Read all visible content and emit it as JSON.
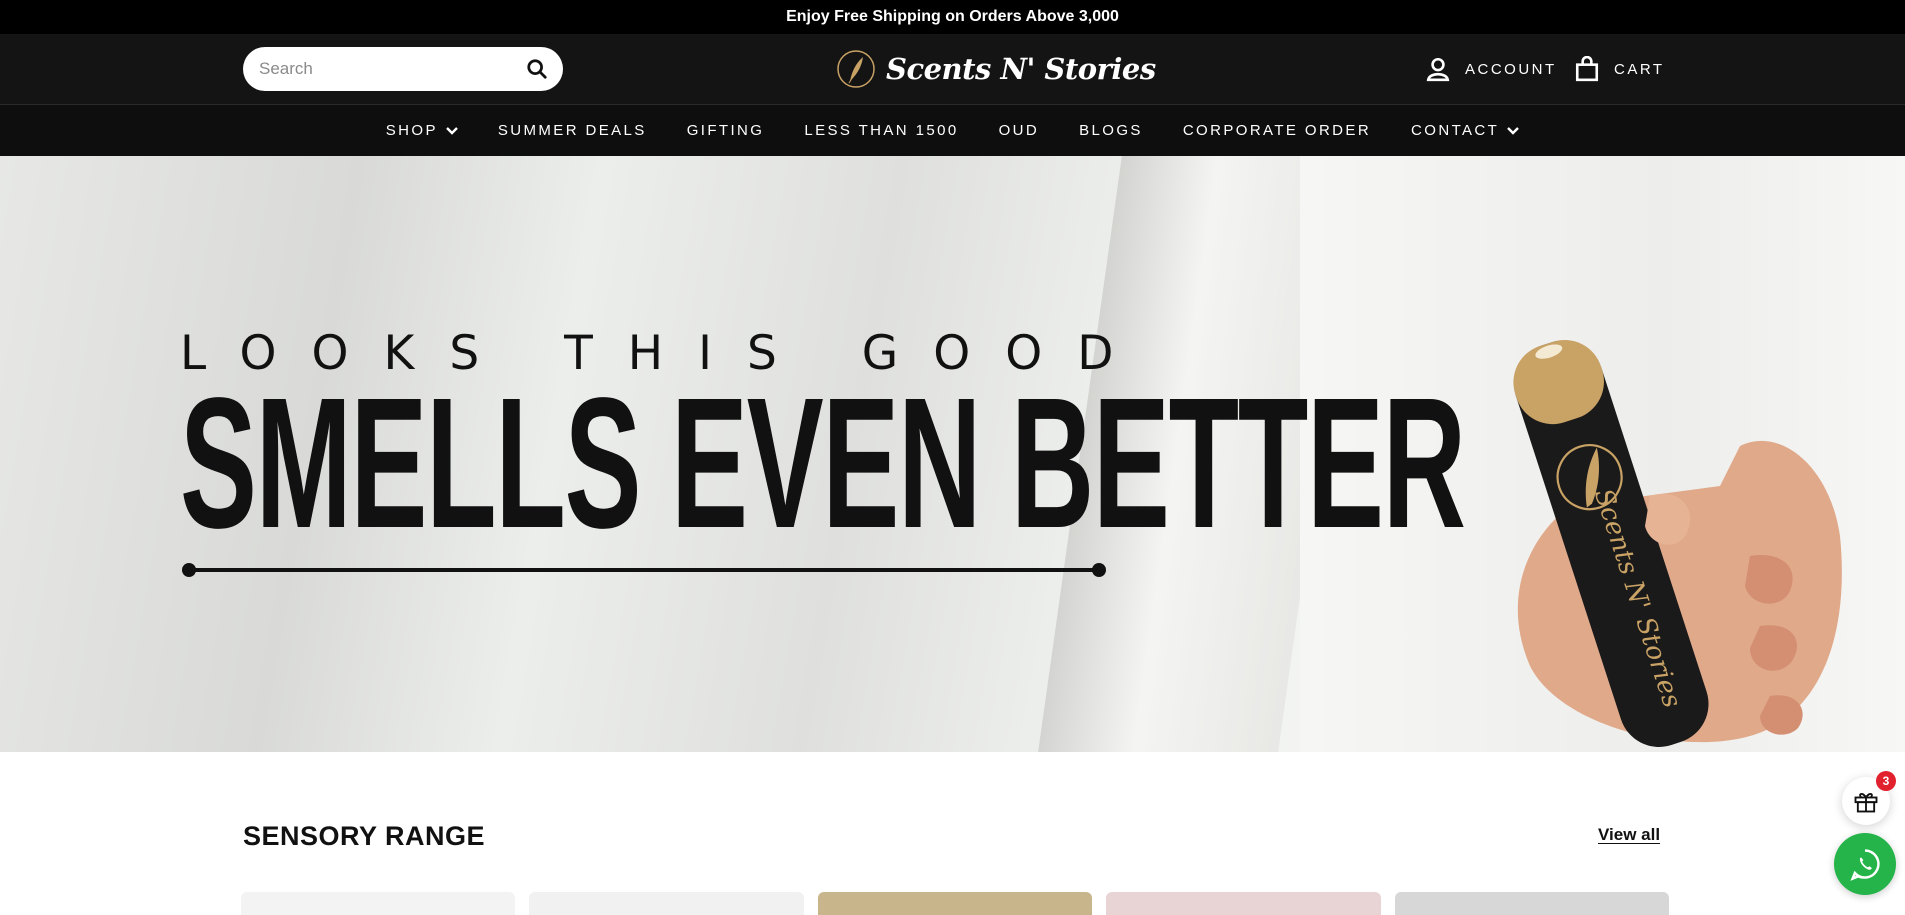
{
  "announcement": {
    "text": "Enjoy Free Shipping on Orders Above 3,000"
  },
  "header": {
    "search": {
      "placeholder": "Search"
    },
    "logo_text": "Scents N' Stories",
    "account_label": "ACCOUNT",
    "cart_label": "CART"
  },
  "nav": {
    "items": [
      {
        "label": "SHOP",
        "has_dropdown": true
      },
      {
        "label": "SUMMER DEALS",
        "has_dropdown": false
      },
      {
        "label": "GIFTING",
        "has_dropdown": false
      },
      {
        "label": "LESS THAN 1500",
        "has_dropdown": false
      },
      {
        "label": "OUD",
        "has_dropdown": false
      },
      {
        "label": "BLOGS",
        "has_dropdown": false
      },
      {
        "label": "CORPORATE ORDER",
        "has_dropdown": false
      },
      {
        "label": "CONTACT",
        "has_dropdown": true
      }
    ]
  },
  "hero": {
    "line1": "LOOKS THIS GOOD",
    "line2": "SMELLS EVEN BETTER",
    "bottle_text": "Scents N' Stories"
  },
  "section": {
    "title": "SENSORY RANGE",
    "view_all": "View all"
  },
  "cards": [
    {
      "color": "#f3f3f3"
    },
    {
      "color": "#f1f1f1"
    },
    {
      "color": "#c9b58c"
    },
    {
      "color": "#e8d4d4"
    },
    {
      "color": "#d7d7d7"
    }
  ],
  "floating": {
    "gift_badge_count": "3",
    "whatsapp_icon": "whatsapp-icon",
    "gift_icon": "gift-icon"
  },
  "colors": {
    "header_bg": "#141414",
    "announcement_bg": "#000000",
    "badge_red": "#e1222e",
    "whatsapp_green": "#25b449",
    "gold": "#c9a265"
  }
}
